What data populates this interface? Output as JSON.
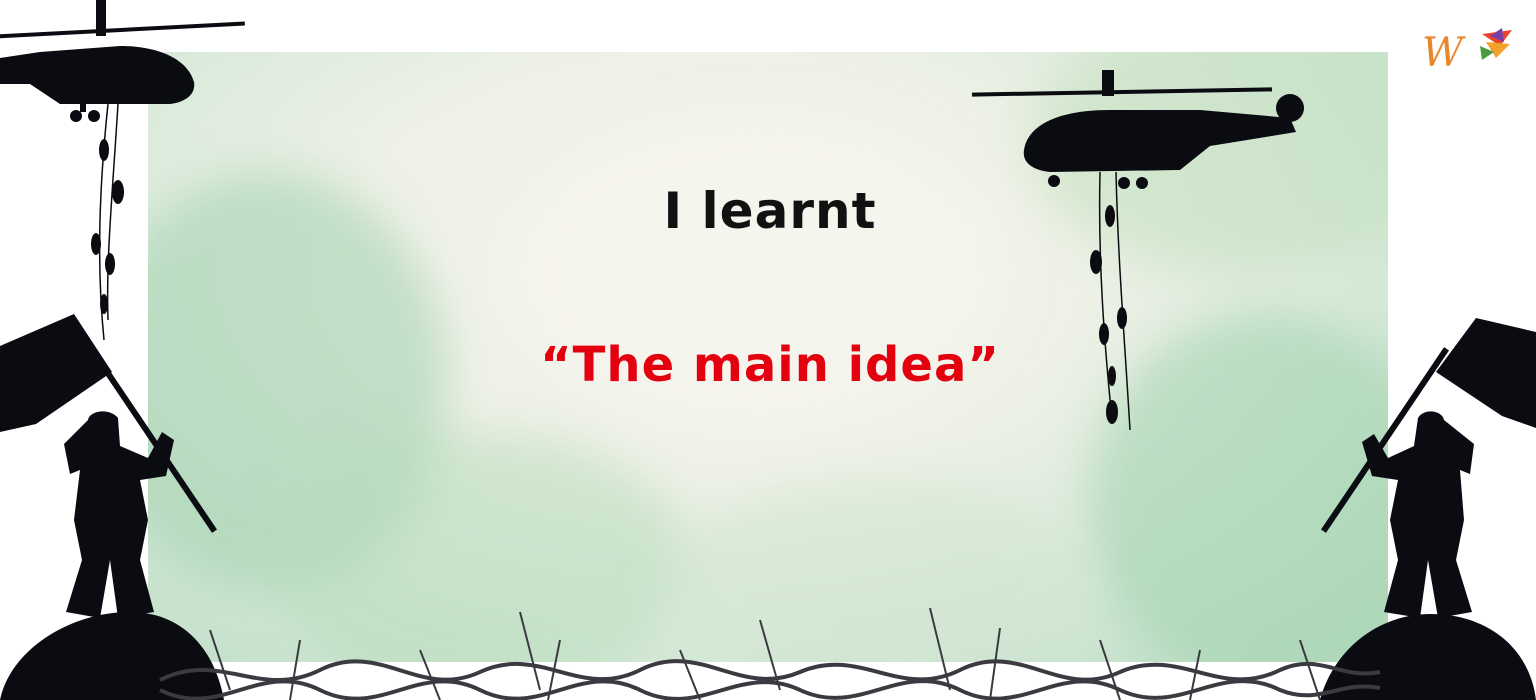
{
  "slide": {
    "title": "I learnt",
    "subtitle": "“The main idea”"
  },
  "logo": {
    "letter": "W",
    "icon": "colorful-w-logo-icon"
  },
  "colors": {
    "title": "#111111",
    "subtitle": "#e3000f",
    "silhouette": "#0b0b12",
    "panel_green": "#b9dcc2",
    "panel_cream": "#f4f3ec"
  }
}
